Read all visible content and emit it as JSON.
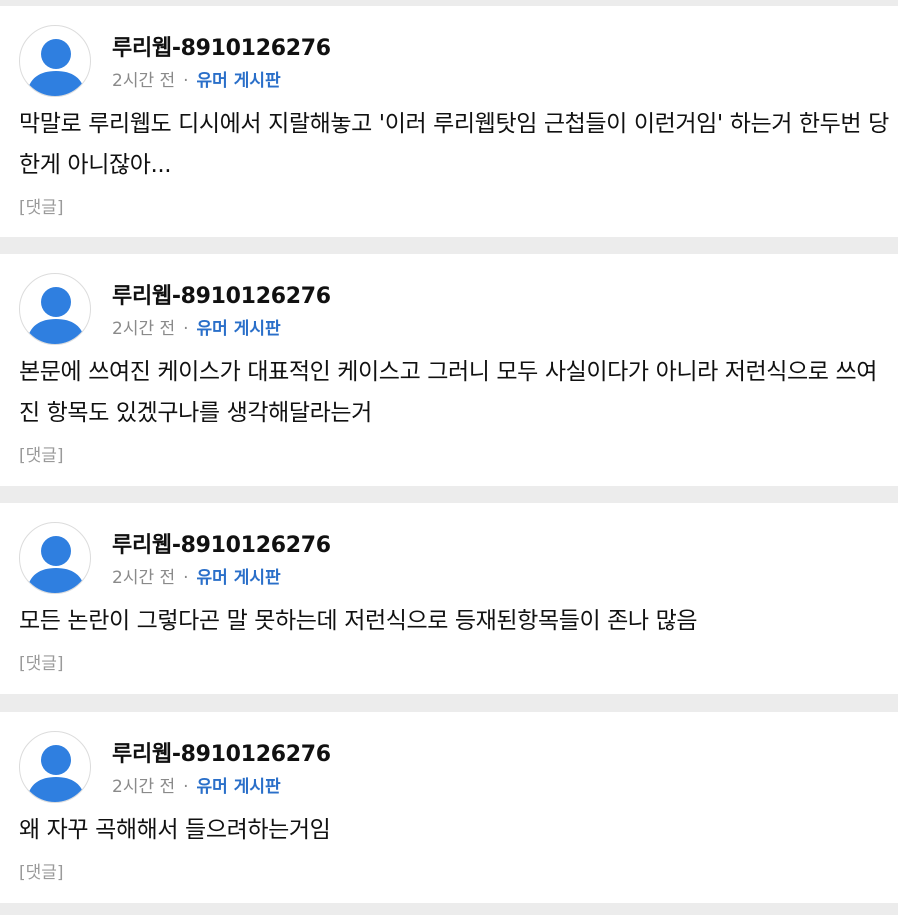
{
  "posts": [
    {
      "author": "루리웹-8910126276",
      "time": "2시간 전",
      "separator": "·",
      "board": "유머 게시판",
      "text": "막말로 루리웹도 디시에서 지랄해놓고 '이러 루리웹탓임 근첩들이 이런거임' 하는거 한두번 당한게 아니잖아...",
      "reply": "[댓글]"
    },
    {
      "author": "루리웹-8910126276",
      "time": "2시간 전",
      "separator": "·",
      "board": "유머 게시판",
      "text": "본문에 쓰여진 케이스가 대표적인 케이스고 그러니 모두 사실이다가 아니라 저런식으로 쓰여진 항목도 있겠구나를 생각해달라는거",
      "reply": "[댓글]"
    },
    {
      "author": "루리웹-8910126276",
      "time": "2시간 전",
      "separator": "·",
      "board": "유머 게시판",
      "text": "모든 논란이 그렇다곤 말 못하는데 저런식으로 등재된항목들이 존나 많음",
      "reply": "[댓글]"
    },
    {
      "author": "루리웹-8910126276",
      "time": "2시간 전",
      "separator": "·",
      "board": "유머 게시판",
      "text": "왜 자꾸 곡해해서 들으려하는거임",
      "reply": "[댓글]"
    }
  ],
  "colors": {
    "avatar": "#2f7fe0",
    "board_link": "#2a6fc9",
    "meta": "#8a8a8a",
    "divider": "#ececec"
  },
  "icons": {
    "avatar": "default-user-avatar-icon"
  }
}
